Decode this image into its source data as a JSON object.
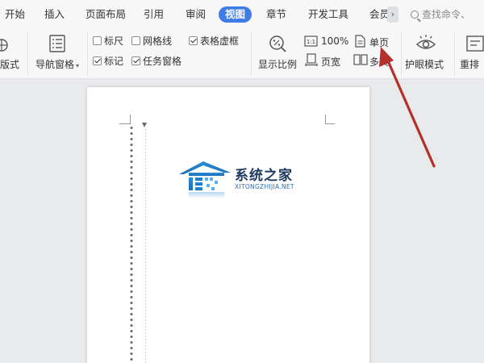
{
  "tabs": [
    {
      "label": "开始",
      "active": false
    },
    {
      "label": "插入",
      "active": false
    },
    {
      "label": "页面布局",
      "active": false
    },
    {
      "label": "引用",
      "active": false
    },
    {
      "label": "审阅",
      "active": false
    },
    {
      "label": "视图",
      "active": true
    },
    {
      "label": "章节",
      "active": false
    },
    {
      "label": "开发工具",
      "active": false
    },
    {
      "label": "会员",
      "active": false
    }
  ],
  "search": {
    "placeholder": "查找命令、"
  },
  "ribbon": {
    "layout_label": "版式",
    "nav_pane_label": "导航窗格",
    "ruler_label": "标尺",
    "gridlines_label": "网格线",
    "table_gridlines_label": "表格虚框",
    "marks_label": "标记",
    "task_pane_label": "任务窗格",
    "zoom_100_label": "100%",
    "single_page_label": "单页",
    "zoom_ratio_label": "显示比例",
    "page_width_label": "页宽",
    "multi_page_label": "多页",
    "eye_mode_label": "护眼模式",
    "rearrange_label": "重排"
  },
  "checkboxes": {
    "ruler": false,
    "gridlines": false,
    "table_gridlines": true,
    "marks": true,
    "task_pane": true
  },
  "watermark": {
    "title": "系统之家",
    "subtitle": "XITONGZHIJIA.NET"
  },
  "colors": {
    "accent": "#3e7ce8",
    "arrow": "#b5302a",
    "logo_blue": "#2b8fd6"
  }
}
